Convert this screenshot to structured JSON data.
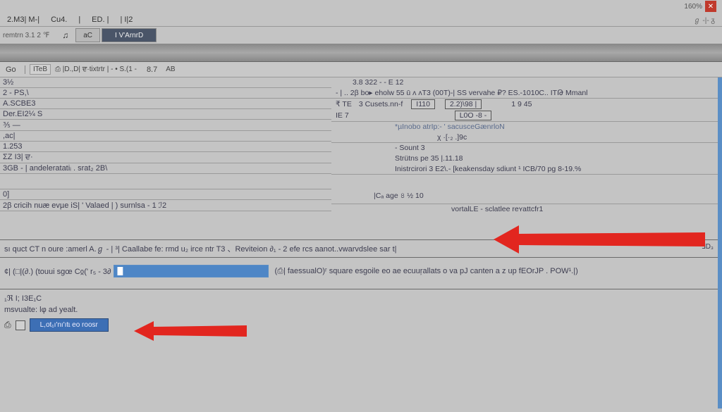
{
  "titlebar": {
    "left": "",
    "percent": "160%",
    "close": "✕"
  },
  "menu": {
    "items": [
      "2.M3|  M-|",
      "Cu4.",
      "|",
      "ED.  |",
      "| I|2"
    ]
  },
  "tabs": {
    "left_label": "remtrn  3.1 2 ℉",
    "icon_label": "♫",
    "tab1": "aC",
    "tab2_active": "I V'ArnrD"
  },
  "formula": {
    "cell": "Go",
    "fx_label": "ITeB",
    "tiny_buttons": "⎙  |D.,D| ਦ·tixtrtr  | - • S.(1 -",
    "number": "8.7",
    "mode": "AB"
  },
  "left_rows": {
    "r0": "3½",
    "r1": "2          - PS,\\",
    "r2": "A.SCBE3",
    "r3": "Der.EI2¼ S",
    "r4": "⅗  —",
    "r5": ",ac|",
    "r6": "1.253",
    "r7": "ΣZ I3|  ਦ·",
    "r8": "3GB - |   andeleratatiᵢ   .  srat₂ 2B\\",
    "r9": "0]",
    "r10": "2β  cricih nuæ evµe iS| '  Valaed |  )       surnlsa  - 1 ℐ2"
  },
  "right_rows": {
    "hdr": "3.8       322  - - Ε          12",
    "r1": "- | .. 2β   bo▸ eholw  55  ū  ʌ ʌT3 (00T)-| SS vervahe  ₽?  ES.-1010C.. ITԹ                                   Mmanl",
    "r2a": "₹              TE",
    "r2b": "3  Cusets.nn-f",
    "r2c": "I110",
    "r2d": "2.2)\\98 |",
    "r2e": "1              9                       45",
    "r3a": "IE              7",
    "r3b": "L0O   -8  -",
    "r4": "*µInobo atrIp:- ' sacusceGænrloN",
    "r5": "χ   ·[·₂  .]9c",
    "r6": "- Sount 3",
    "r7": "Strütns pe  35   |.11.18",
    "r8": "Inistrcirori 3  E2\\.- [keakensday  sdiunt  ¹ ICB/70 pg                                8-19.%",
    "r9": "|Cₐ  age  ৪  ½     10",
    "r10": "vortalLE      -   sclatlee  reʏattcfr1",
    "far_right": "ℲD₃"
  },
  "long_text": "sı   quct  CT n oure :amerl A.ℊ - | ³|  Caallabe  fe: rmd u₂ irce  ntr T3 、Reviteion  ∂₁ -  2 efe rcs  aanot..vwarvdslee sar t|",
  "input_row": {
    "prefix": "¢|  (□|(∂.)  (touui sgœ  Cჲ(' r₅   - 3∂",
    "value": "█",
    "suffix": "(⎙| faessualO)ʳ  square  esgoile   eo  ae ecuuŗallats  o   va   pJ  canten   a  z up  fEOrJP .  POW¹.|)"
  },
  "bottom": {
    "sect_label": "₁ℜ   Ι; I3E₁C",
    "msg": "msvualte:   lφ  ad  yealt.",
    "checkbox": "⎙",
    "button": "L,ot₁ı'nı'ıtɩ eo roosr"
  },
  "colors": {
    "accent_blue": "#4e86c6",
    "arrow_red": "#e2261f",
    "window_bg": "#c4c4c4"
  }
}
